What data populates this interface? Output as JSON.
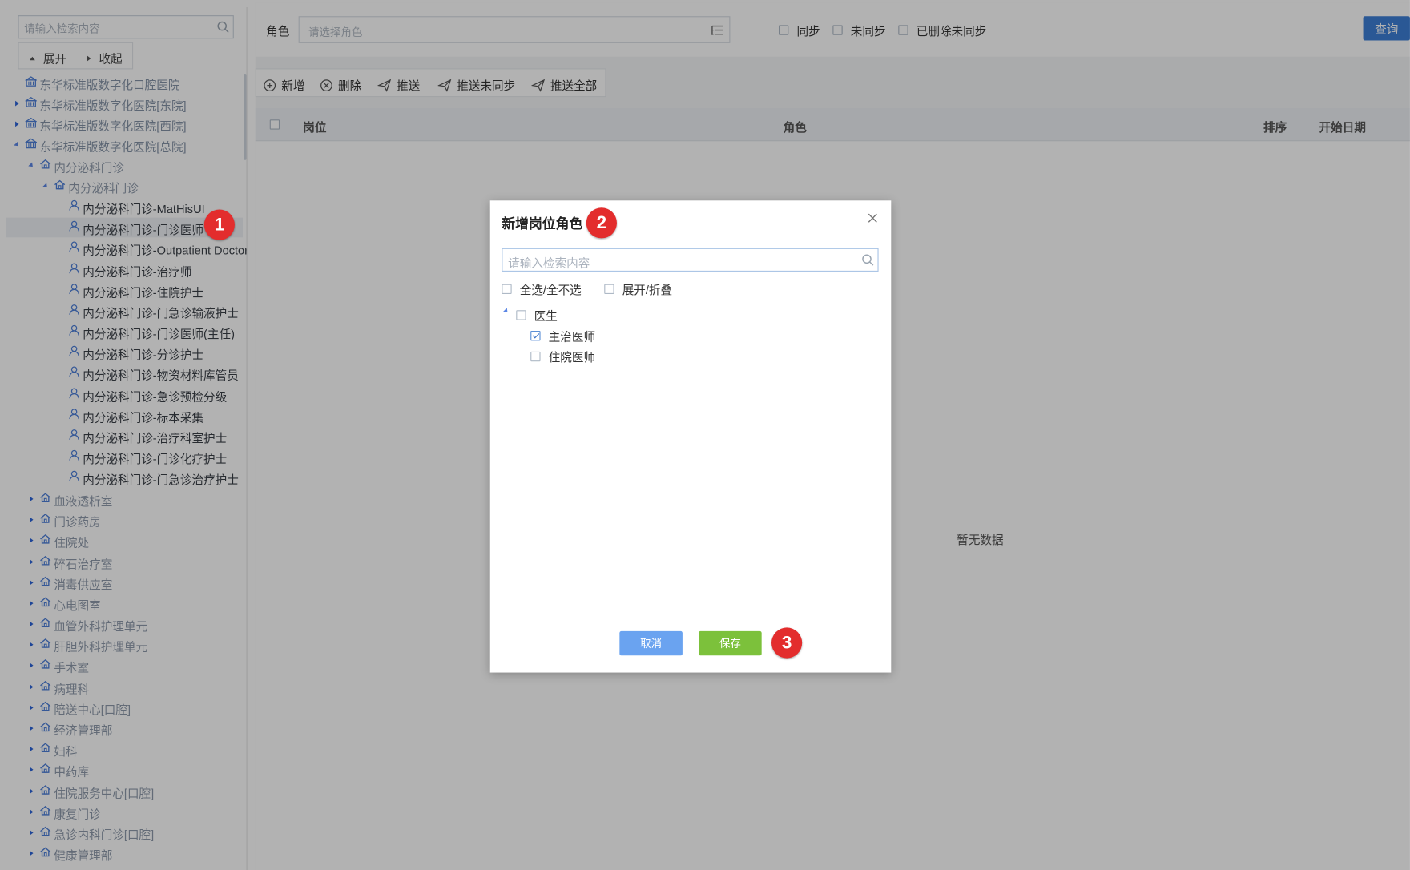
{
  "tree_panel": {
    "search_placeholder": "请输入检索内容",
    "expand_label": "展开",
    "collapse_label": "收起",
    "hospitals": [
      "东华标准版数字化口腔医院",
      "东华标准版数字化医院[东院]",
      "东华标准版数字化医院[西院]",
      "东华标准版数字化医院[总院]"
    ],
    "dept_parent": "内分泌科门诊",
    "dept_child": "内分泌科门诊",
    "posts": [
      "内分泌科门诊-MatHisUI",
      "内分泌科门诊-门诊医师",
      "内分泌科门诊-Outpatient Doctor",
      "内分泌科门诊-治疗师",
      "内分泌科门诊-住院护士",
      "内分泌科门诊-门急诊输液护士",
      "内分泌科门诊-门诊医师(主任)",
      "内分泌科门诊-分诊护士",
      "内分泌科门诊-物资材料库管员",
      "内分泌科门诊-急诊预检分级",
      "内分泌科门诊-标本采集",
      "内分泌科门诊-治疗科室护士",
      "内分泌科门诊-门诊化疗护士",
      "内分泌科门诊-门急诊治疗护士"
    ],
    "other_depts": [
      "血液透析室",
      "门诊药房",
      "住院处",
      "碎石治疗室",
      "消毒供应室",
      "心电图室",
      "血管外科护理单元",
      "肝胆外科护理单元",
      "手术室",
      "病理科",
      "陪送中心[口腔]",
      "经济管理部",
      "妇科",
      "中药库",
      "住院服务中心[口腔]",
      "康复门诊",
      "急诊内科门诊[口腔]",
      "健康管理部"
    ]
  },
  "filter_bar": {
    "role_label": "角色",
    "role_placeholder": "请选择角色",
    "sync_label": "同步",
    "unsync_label": "未同步",
    "deleted_unsync_label": "已删除未同步",
    "query_label": "查询"
  },
  "toolbar": {
    "add": "新增",
    "delete": "删除",
    "push": "推送",
    "push_unsync": "推送未同步",
    "push_all": "推送全部"
  },
  "grid": {
    "columns": [
      "岗位",
      "角色",
      "排序",
      "开始日期"
    ],
    "empty_text": "暂无数据"
  },
  "modal": {
    "title": "新增岗位角色",
    "search_placeholder": "请输入检索内容",
    "select_all_label": "全选/全不选",
    "expand_collapse_label": "展开/折叠",
    "tree": {
      "root": "医生",
      "children": [
        {
          "label": "主治医师",
          "checked": true
        },
        {
          "label": "住院医师",
          "checked": false
        }
      ]
    },
    "cancel_label": "取消",
    "save_label": "保存"
  },
  "markers": [
    "1",
    "2",
    "3"
  ],
  "colors": {
    "primary": "#3d7fd6",
    "save": "#7cc13b",
    "cancel": "#6aa3f0",
    "marker": "#e32d2d"
  }
}
